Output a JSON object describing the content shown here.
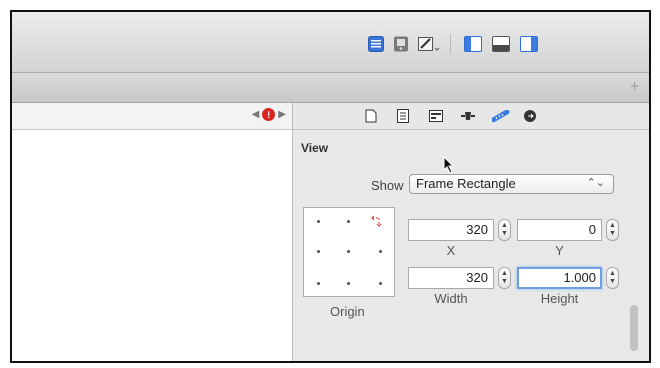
{
  "toolbar": {
    "icons": [
      "list-view-icon",
      "device-icon",
      "edit-icon",
      "navigator-panel-icon",
      "debug-panel-icon",
      "utilities-panel-icon"
    ],
    "accent": "#3b74d9"
  },
  "filter_bar": {
    "add_symbol": "+"
  },
  "jump_bar": {
    "prev": "◀",
    "issue_count": "!",
    "next": "▶"
  },
  "inspector": {
    "tabs": [
      "file-icon",
      "quick-help-icon",
      "identity-icon",
      "attributes-icon",
      "size-icon",
      "connections-icon"
    ],
    "section_title": "View",
    "show_label": "Show",
    "show_value": "Frame Rectangle",
    "popup_arrows": "⌃⌄",
    "origin_label": "Origin",
    "fields": {
      "x": {
        "value": "320",
        "label": "X"
      },
      "y": {
        "value": "0",
        "label": "Y"
      },
      "width": {
        "value": "320",
        "label": "Width"
      },
      "height": {
        "value": "1.000",
        "label": "Height"
      }
    }
  }
}
